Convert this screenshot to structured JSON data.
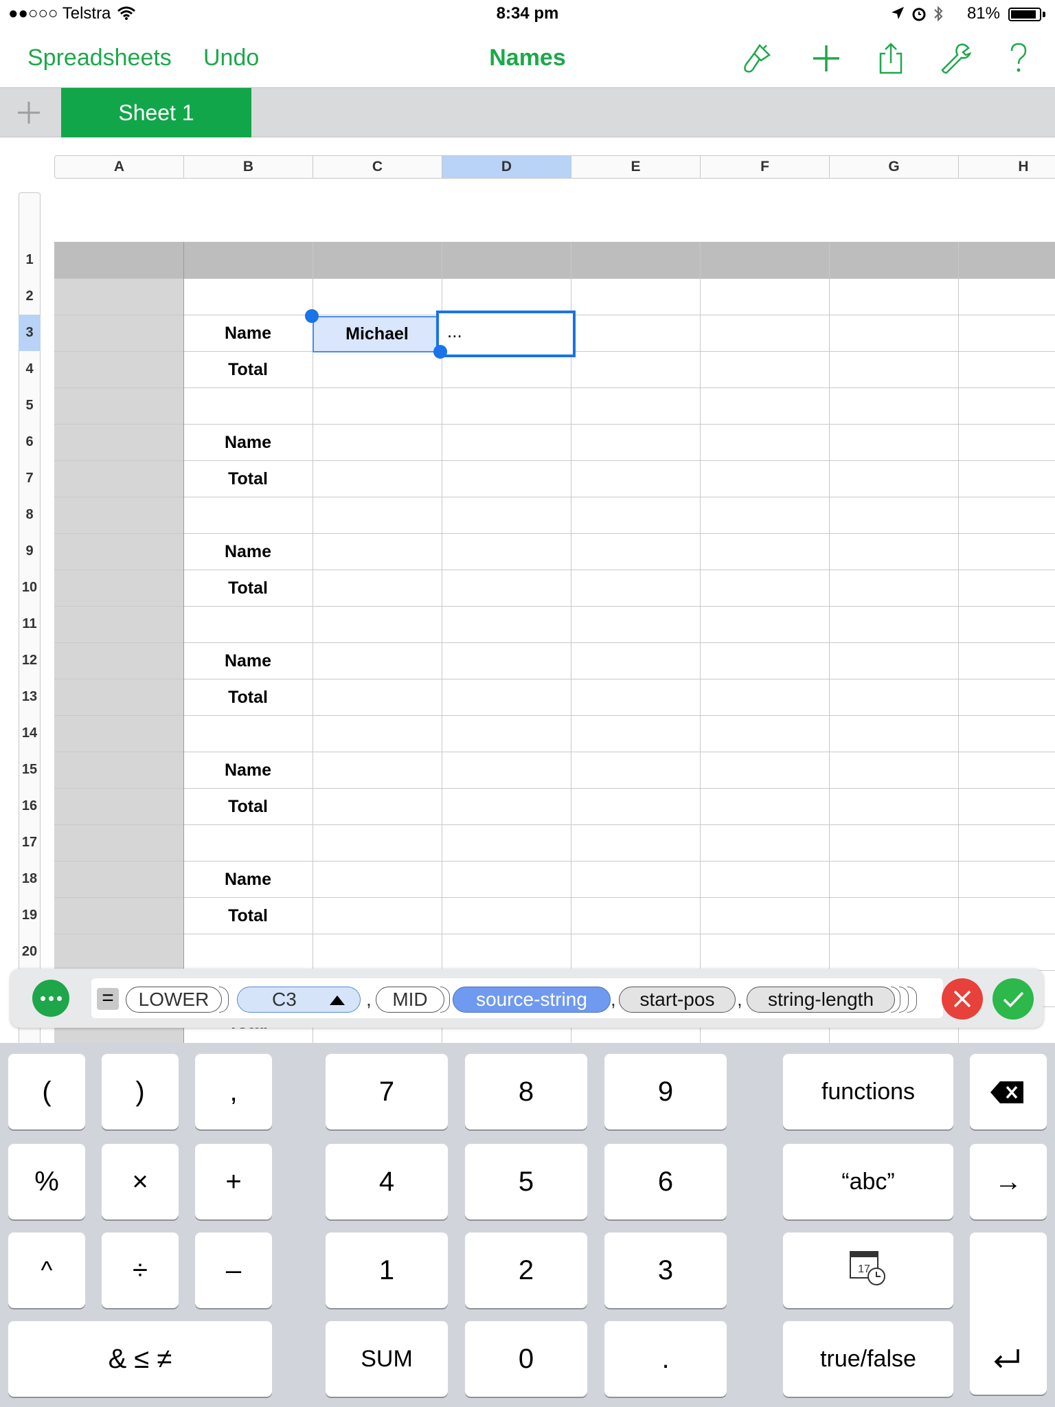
{
  "status": {
    "carrier": "●●○○○ Telstra",
    "time": "8:34 pm",
    "battery": "81%"
  },
  "toolbar": {
    "back_label": "Spreadsheets",
    "undo_label": "Undo",
    "title": "Names",
    "icons": [
      "paintbrush-icon",
      "plus-icon",
      "share-icon",
      "wrench-icon",
      "help-icon"
    ],
    "accent": "#1da84b"
  },
  "tabs": {
    "active": "Sheet 1",
    "active_color": "#12a64a"
  },
  "sheet": {
    "columns": [
      "A",
      "B",
      "C",
      "D",
      "E",
      "F",
      "G",
      "H"
    ],
    "selected_column": "D",
    "rows": [
      "1",
      "2",
      "3",
      "4",
      "5",
      "6",
      "7",
      "8",
      "9",
      "10",
      "11",
      "12",
      "13",
      "14",
      "15",
      "16",
      "17",
      "18",
      "19",
      "20"
    ],
    "selected_row": "3",
    "column_b": [
      "",
      "",
      "Name",
      "Total",
      "",
      "Name",
      "Total",
      "",
      "Name",
      "Total",
      "",
      "Name",
      "Total",
      "",
      "Name",
      "Total",
      "",
      "Name",
      "Total",
      ""
    ],
    "cell_c3": "Michael",
    "cell_d3": "...",
    "partial_row_label": "Total"
  },
  "formula": {
    "equals": "=",
    "tokens": {
      "lower": "LOWER",
      "ref": "C3",
      "mid": "MID",
      "source": "source-string",
      "start": "start-pos",
      "length": "string-length"
    },
    "comma": ","
  },
  "keyboard": {
    "open_paren": "(",
    "close_paren": ")",
    "comma": ",",
    "percent": "%",
    "times": "×",
    "plus": "+",
    "caret": "^",
    "divide": "÷",
    "minus": "–",
    "amp": "& ≤ ≠",
    "sum": "SUM",
    "d7": "7",
    "d8": "8",
    "d9": "9",
    "d4": "4",
    "d5": "5",
    "d6": "6",
    "d1": "1",
    "d2": "2",
    "d3": "3",
    "d0": "0",
    "dot": ".",
    "functions": "functions",
    "abc": "“abc”",
    "truefalse": "true/false",
    "tab": "→",
    "calendar_day": "17"
  }
}
